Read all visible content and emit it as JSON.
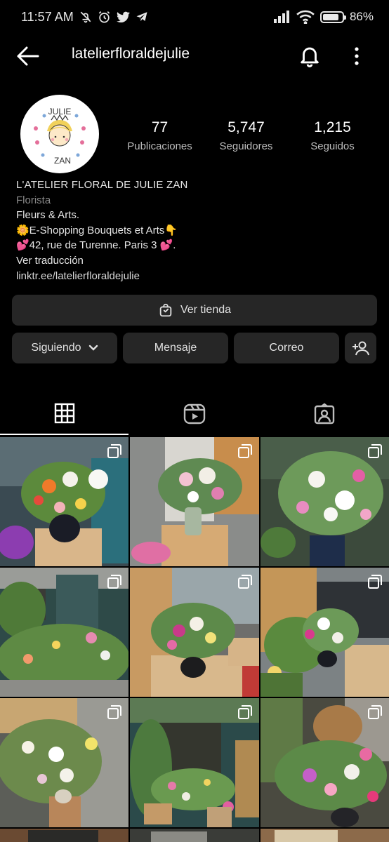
{
  "status_bar": {
    "time": "11:57 AM",
    "battery": "86%",
    "battery_level": 0.86,
    "icons": [
      "mute-icon",
      "alarm-icon",
      "twitter-icon",
      "telegram-icon",
      "signal-icon",
      "wifi-icon",
      "battery-icon"
    ]
  },
  "header": {
    "username": "latelierfloraldejulie",
    "icons": [
      "back-arrow-icon",
      "bell-icon",
      "more-vertical-icon"
    ]
  },
  "profile": {
    "avatar_text_top": "JULIE",
    "avatar_text_bottom": "ZAN",
    "stats": [
      {
        "value": "77",
        "label": "Publicaciones"
      },
      {
        "value": "5,747",
        "label": "Seguidores"
      },
      {
        "value": "1,215",
        "label": "Seguidos"
      }
    ],
    "name": "L'ATELIER FLORAL DE JULIE ZAN",
    "category": "Florista",
    "bio_lines": [
      "Fleurs & Arts.",
      "🌼E-Shopping Bouquets et Arts👇",
      "💕42, rue de Turenne. Paris 3 💕."
    ],
    "translate": "Ver traducción",
    "link": "linktr.ee/latelierfloraldejulie"
  },
  "buttons": {
    "shop": "Ver tienda",
    "following": "Siguiendo",
    "message": "Mensaje",
    "email": "Correo"
  },
  "tabs": [
    "grid-icon",
    "reels-icon",
    "tagged-icon"
  ],
  "colors": {
    "background": "#000000",
    "button_bg": "#262626",
    "text": "#ffffff",
    "muted": "#8a8a8a"
  },
  "posts": [
    {
      "caption": "",
      "multiple": true
    },
    {
      "caption": "",
      "multiple": true
    },
    {
      "caption": "",
      "multiple": true
    },
    {
      "caption": "",
      "multiple": true
    },
    {
      "caption": "",
      "multiple": true
    },
    {
      "caption": "",
      "multiple": true
    },
    {
      "caption": "",
      "multiple": true
    },
    {
      "caption": "",
      "multiple": true
    },
    {
      "caption": "",
      "multiple": true
    }
  ]
}
